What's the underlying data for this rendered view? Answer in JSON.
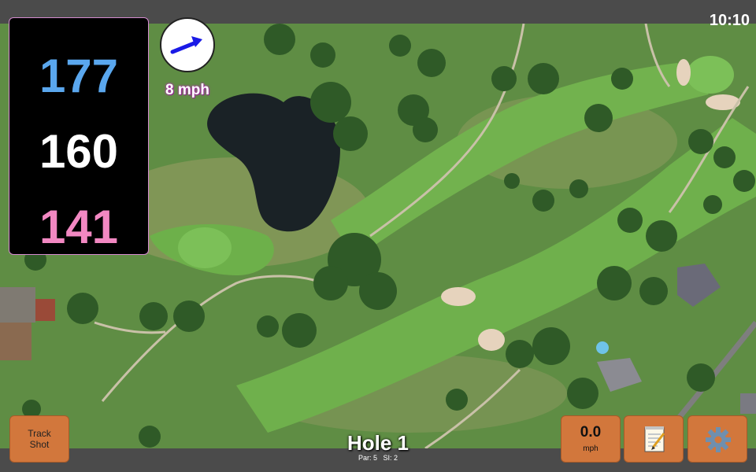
{
  "status": {
    "time": "10:10"
  },
  "distances": {
    "back": "177",
    "middle": "160",
    "front": "141"
  },
  "wind": {
    "speed_label": "8 mph",
    "direction_icon": "arrow-east-icon"
  },
  "buttons": {
    "track_shot": {
      "line1": "Track",
      "line2": "Shot"
    },
    "speed": {
      "value": "0.0",
      "unit": "mph"
    },
    "notes_icon": "notepad-icon",
    "settings_icon": "gear-icon"
  },
  "hole": {
    "title": "Hole 1",
    "par": "Par: 5",
    "si": "SI: 2"
  },
  "colors": {
    "back_distance": "#5aa7ee",
    "middle_distance": "#ffffff",
    "front_distance": "#f288c2",
    "button_orange": "#d2773c",
    "wind_arrow": "#1a1ae6"
  }
}
